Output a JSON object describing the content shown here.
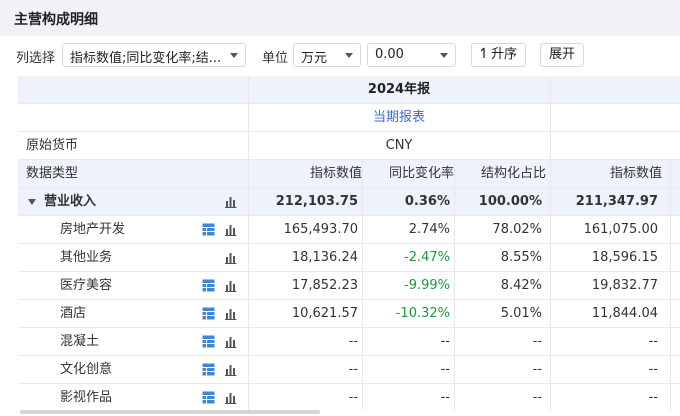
{
  "panel": {
    "title": "主营构成明细"
  },
  "toolbar": {
    "columns_label": "列选择",
    "columns_value": "指标数值;同比变化率;结...",
    "unit_label": "单位",
    "unit_value": "万元",
    "threshold_value": "0.00",
    "sort_button": "升序",
    "expand_button": "展开"
  },
  "table": {
    "period_title": "2024年报",
    "report_link": "当期报表",
    "currency_label": "原始货币",
    "currency_value": "CNY",
    "type_label": "数据类型",
    "headers": [
      "指标数值",
      "同比变化率",
      "结构化占比",
      "指标数值"
    ],
    "rows": [
      {
        "name": "营业收入",
        "value": "212,103.75",
        "yoy": "0.36%",
        "share": "100.00%",
        "prev": "211,347.97",
        "bold": true,
        "expand": true,
        "table_icon": false
      },
      {
        "name": "房地产开发",
        "value": "165,493.70",
        "yoy": "2.74%",
        "share": "78.02%",
        "prev": "161,075.00",
        "table_icon": true
      },
      {
        "name": "其他业务",
        "value": "18,136.24",
        "yoy": "-2.47%",
        "share": "8.55%",
        "prev": "18,596.15",
        "table_icon": false
      },
      {
        "name": "医疗美容",
        "value": "17,852.23",
        "yoy": "-9.99%",
        "share": "8.42%",
        "prev": "19,832.77",
        "table_icon": true
      },
      {
        "name": "酒店",
        "value": "10,621.57",
        "yoy": "-10.32%",
        "share": "5.01%",
        "prev": "11,844.04",
        "table_icon": true
      },
      {
        "name": "混凝土",
        "value": "--",
        "yoy": "--",
        "share": "--",
        "prev": "--",
        "table_icon": true
      },
      {
        "name": "文化创意",
        "value": "--",
        "yoy": "--",
        "share": "--",
        "prev": "--",
        "table_icon": true
      },
      {
        "name": "影视作品",
        "value": "--",
        "yoy": "--",
        "share": "--",
        "prev": "--",
        "table_icon": true
      }
    ]
  },
  "colors": {
    "negative": "#1c9a3a",
    "link": "#3a6fd0",
    "icon": "#3f86d8",
    "header_bg": "#eef3fb"
  },
  "icons": {
    "expand": "triangle-down-icon",
    "table": "table-icon",
    "chart": "bar-chart-icon",
    "sort": "sort-ascending-icon",
    "dropdown": "chevron-down-icon"
  }
}
